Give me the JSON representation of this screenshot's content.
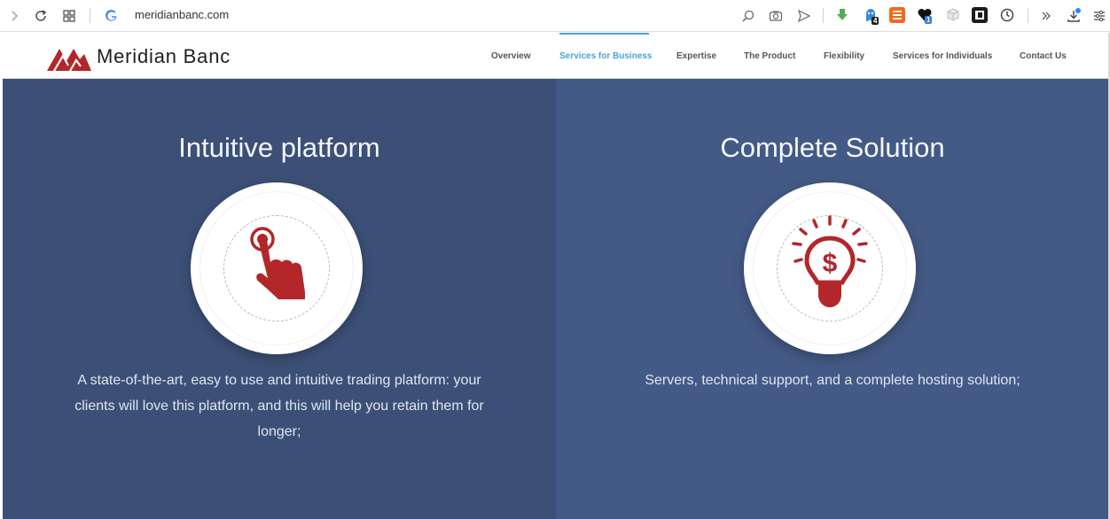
{
  "browser": {
    "url": "meridianbanc.com",
    "extensions": [
      {
        "icon": "download-arrow-icon",
        "color": "#4caf50"
      },
      {
        "icon": "ghost-icon",
        "color": "#3b8ad9",
        "badge": "4"
      },
      {
        "icon": "stack-icon",
        "color": "#f06a1d"
      },
      {
        "icon": "heart-icon",
        "color": "#111111",
        "badge": "1"
      },
      {
        "icon": "cube-icon",
        "color": "#bdbdbd"
      },
      {
        "icon": "frame-icon",
        "color": "#1c1c1c"
      },
      {
        "icon": "clock-icon",
        "color": "#444444"
      }
    ]
  },
  "site": {
    "brand": "Meridian Banc",
    "nav": [
      {
        "label": "Overview",
        "active": false
      },
      {
        "label": "Services for Business",
        "active": true
      },
      {
        "label": "Expertise",
        "active": false
      },
      {
        "label": "The Product",
        "active": false
      },
      {
        "label": "Flexibility",
        "active": false
      },
      {
        "label": "Services for Individuals",
        "active": false
      },
      {
        "label": "Contact Us",
        "active": false
      }
    ],
    "accent": "#4aa3d8",
    "brand_red": "#b3262a"
  },
  "features": [
    {
      "title": "Intuitive platform",
      "icon": "hand-pointer-icon",
      "description": "A state-of-the-art, easy to use and intuitive trading platform: your clients will love this platform, and this will help you retain them for longer;"
    },
    {
      "title": "Complete Solution",
      "icon": "lightbulb-dollar-icon",
      "description": "Servers, technical support, and a complete hosting solution;"
    }
  ]
}
